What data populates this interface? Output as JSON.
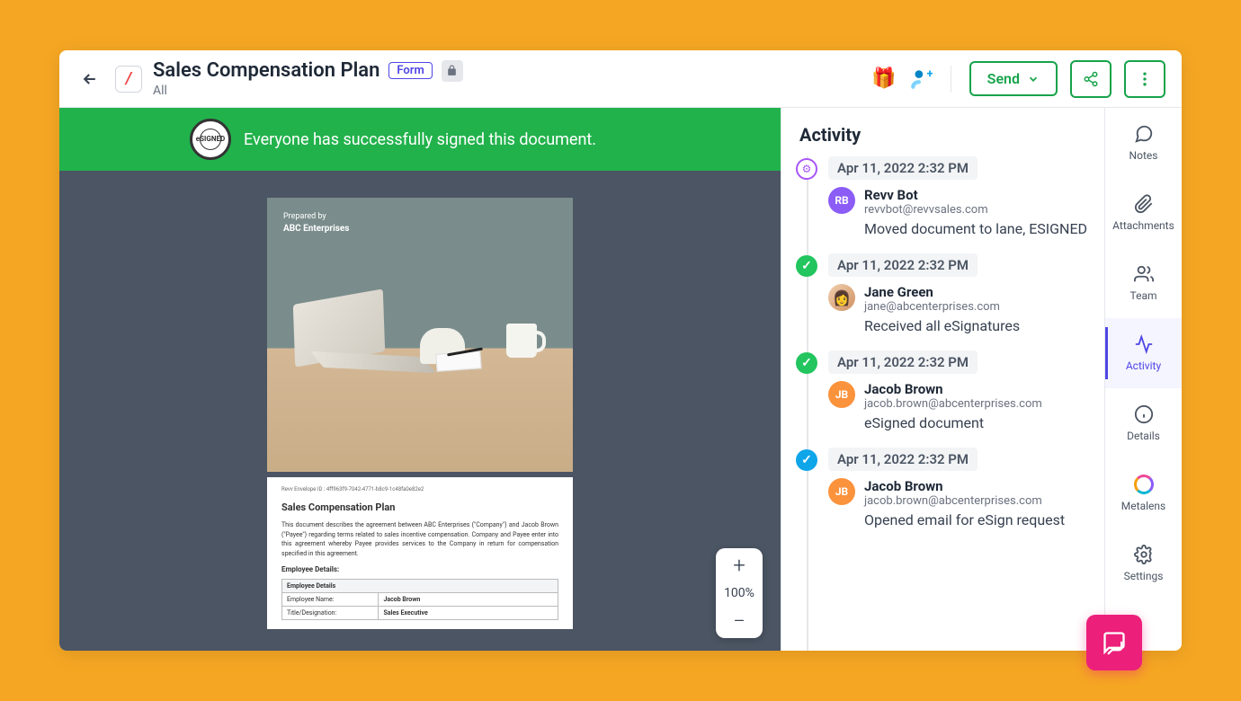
{
  "header": {
    "title": "Sales Compensation Plan",
    "badge": "Form",
    "subtitle": "All",
    "send_label": "Send"
  },
  "banner": {
    "message": "Everyone has successfully signed this document.",
    "stamp": "eSIGNED"
  },
  "document": {
    "page1": {
      "prepared_by_label": "Prepared by",
      "company": "ABC Enterprises"
    },
    "page2": {
      "envelope_id_label": "Revv Envelope ID",
      "envelope_id": "4ff963f9-7042-4771-b8c9-1c48fa0e82e2",
      "title": "Sales Compensation Plan",
      "body": "This document describes the agreement between ABC Enterprises (\"Company\") and Jacob Brown (\"Payee\") regarding terms related to sales incentive compensation. Company and Payee enter into this agreement whereby Payee provides services to the Company in return for compensation specified in this agreement.",
      "employee_details_label": "Employee Details:",
      "table": {
        "header": "Employee Details",
        "row1_label": "Employee Name:",
        "row1_value": "Jacob Brown",
        "row2_label": "Title/Designation:",
        "row2_value": "Sales Executive"
      }
    }
  },
  "zoom": {
    "level": "100%"
  },
  "activity": {
    "title": "Activity",
    "events": [
      {
        "icon_type": "gear",
        "time": "Apr 11, 2022 2:32 PM",
        "avatar_type": "rb",
        "avatar_text": "RB",
        "name": "Revv Bot",
        "email": "revvbot@revvsales.com",
        "desc": "Moved document to lane, ESIGNED"
      },
      {
        "icon_type": "check-green",
        "time": "Apr 11, 2022 2:32 PM",
        "avatar_type": "jane",
        "avatar_text": "👩",
        "name": "Jane Green",
        "email": "jane@abcenterprises.com",
        "desc": "Received all eSignatures"
      },
      {
        "icon_type": "check-green",
        "time": "Apr 11, 2022 2:32 PM",
        "avatar_type": "jb",
        "avatar_text": "JB",
        "name": "Jacob Brown",
        "email": "jacob.brown@abcenterprises.com",
        "desc": "eSigned document"
      },
      {
        "icon_type": "check-blue",
        "time": "Apr 11, 2022 2:32 PM",
        "avatar_type": "jb",
        "avatar_text": "JB",
        "name": "Jacob Brown",
        "email": "jacob.brown@abcenterprises.com",
        "desc": "Opened email for eSign request"
      }
    ]
  },
  "rail": {
    "items": [
      {
        "id": "notes",
        "label": "Notes"
      },
      {
        "id": "attachments",
        "label": "Attachments"
      },
      {
        "id": "team",
        "label": "Team"
      },
      {
        "id": "activity",
        "label": "Activity"
      },
      {
        "id": "details",
        "label": "Details"
      },
      {
        "id": "metalens",
        "label": "Metalens"
      },
      {
        "id": "settings",
        "label": "Settings"
      }
    ]
  }
}
